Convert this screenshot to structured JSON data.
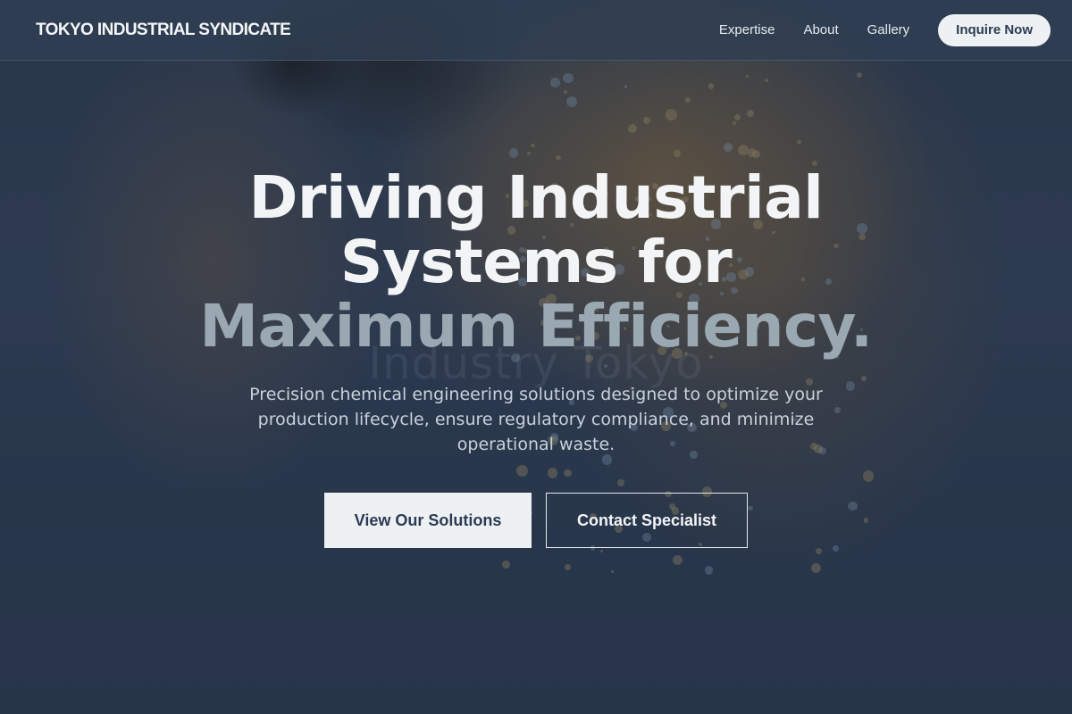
{
  "header": {
    "brand": "TOKYO INDUSTRIAL SYNDICATE",
    "nav": [
      {
        "label": "Expertise"
      },
      {
        "label": "About"
      },
      {
        "label": "Gallery"
      }
    ],
    "cta_label": "Inquire Now"
  },
  "hero": {
    "headline_lines": [
      "Driving Industrial",
      "Systems for",
      "Maximum Efficiency."
    ],
    "watermark": "Industry Tokyo",
    "subtext": "Precision chemical engineering solutions designed to optimize your production lifecycle, ensure regulatory compliance, and minimize operational waste.",
    "primary_button": "View Our Solutions",
    "secondary_button": "Contact Specialist"
  },
  "colors": {
    "background": "#2b3a50",
    "header_bg": "#303e52",
    "button_light": "#eef1f4",
    "button_text": "#2a3b52",
    "headline_accent": "#9aa8b2"
  }
}
